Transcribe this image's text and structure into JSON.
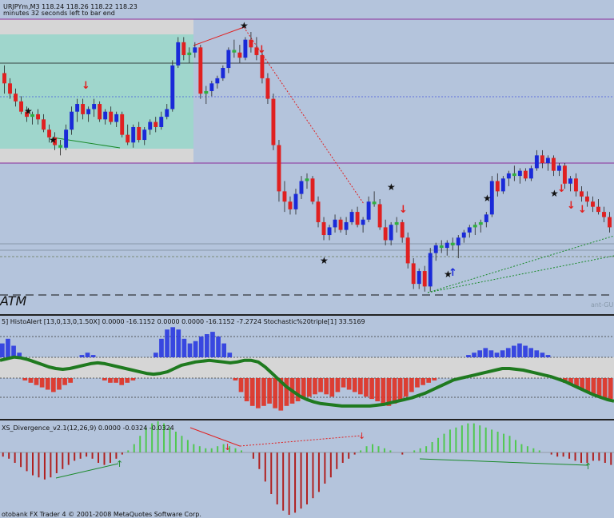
{
  "main": {
    "title_line": "URJPYm,M3  118.24 118.26 118.22 118.23",
    "timer_line": "minutes 32 seconds left to bar end",
    "atm_label": "ATM",
    "watermark": "ant-GU"
  },
  "panel1": {
    "title": "5] HistoAlert [13,0,13,0,1.50X] 0.0000 -16.1152 0.0000 0.0000 -16.1152 -7.2724  Stochastic%20triple[1] 33.5169"
  },
  "panel2": {
    "title": "XS_Divergence_v2.1(12,26,9) 0.0000 -0.0324 -0.0324"
  },
  "footer": {
    "text": "otobank FX Trader 4  © 2001-2008 MetaQuotes Software Corp."
  },
  "colors": {
    "background": "#b4c4dc",
    "bull": "#1a2ad8",
    "bear": "#e02020",
    "neutral": "#30b040",
    "zone": "#9fd6cc",
    "zone_gray": "#d6d6d6",
    "stoch": "#1f7a1f",
    "histo_up": "#2a3ae0",
    "histo_dn": "#e03020",
    "macd_up": "#50c850",
    "macd_dn": "#b02020",
    "purple": "#8a2b9a"
  },
  "chart_data": [
    {
      "type": "candlestick",
      "ylim": [
        0,
        100
      ],
      "candles": [
        {
          "o": 70,
          "h": 73,
          "l": 62,
          "c": 66
        },
        {
          "o": 66,
          "h": 68,
          "l": 60,
          "c": 62
        },
        {
          "o": 62,
          "h": 64,
          "l": 57,
          "c": 59
        },
        {
          "o": 59,
          "h": 61,
          "l": 54,
          "c": 55
        },
        {
          "o": 55,
          "h": 57,
          "l": 51,
          "c": 53
        },
        {
          "o": 53,
          "h": 55,
          "l": 50,
          "c": 54
        },
        {
          "o": 54,
          "h": 56,
          "l": 50,
          "c": 52
        },
        {
          "o": 52,
          "h": 54,
          "l": 47,
          "c": 48
        },
        {
          "o": 48,
          "h": 50,
          "l": 43,
          "c": 45
        },
        {
          "o": 45,
          "h": 47,
          "l": 40,
          "c": 42
        },
        {
          "o": 42,
          "h": 44,
          "l": 38,
          "c": 41
        },
        {
          "o": 41,
          "h": 50,
          "l": 40,
          "c": 48
        },
        {
          "o": 48,
          "h": 57,
          "l": 46,
          "c": 55
        },
        {
          "o": 55,
          "h": 60,
          "l": 51,
          "c": 58
        },
        {
          "o": 58,
          "h": 60,
          "l": 52,
          "c": 54
        },
        {
          "o": 54,
          "h": 57,
          "l": 51,
          "c": 56
        },
        {
          "o": 56,
          "h": 60,
          "l": 53,
          "c": 58
        },
        {
          "o": 58,
          "h": 59,
          "l": 51,
          "c": 52
        },
        {
          "o": 52,
          "h": 56,
          "l": 50,
          "c": 55
        },
        {
          "o": 55,
          "h": 57,
          "l": 50,
          "c": 51
        },
        {
          "o": 51,
          "h": 55,
          "l": 49,
          "c": 54
        },
        {
          "o": 54,
          "h": 55,
          "l": 45,
          "c": 46
        },
        {
          "o": 46,
          "h": 50,
          "l": 42,
          "c": 43
        },
        {
          "o": 43,
          "h": 50,
          "l": 41,
          "c": 49
        },
        {
          "o": 49,
          "h": 51,
          "l": 43,
          "c": 44
        },
        {
          "o": 44,
          "h": 49,
          "l": 42,
          "c": 48
        },
        {
          "o": 48,
          "h": 52,
          "l": 46,
          "c": 51
        },
        {
          "o": 51,
          "h": 53,
          "l": 47,
          "c": 49
        },
        {
          "o": 49,
          "h": 55,
          "l": 48,
          "c": 53
        },
        {
          "o": 53,
          "h": 58,
          "l": 52,
          "c": 56
        },
        {
          "o": 56,
          "h": 75,
          "l": 55,
          "c": 73
        },
        {
          "o": 73,
          "h": 84,
          "l": 72,
          "c": 82
        },
        {
          "o": 82,
          "h": 84,
          "l": 75,
          "c": 77
        },
        {
          "o": 77,
          "h": 80,
          "l": 74,
          "c": 78
        },
        {
          "o": 78,
          "h": 82,
          "l": 76,
          "c": 80
        },
        {
          "o": 80,
          "h": 81,
          "l": 60,
          "c": 62
        },
        {
          "o": 62,
          "h": 65,
          "l": 58,
          "c": 63
        },
        {
          "o": 63,
          "h": 67,
          "l": 61,
          "c": 66
        },
        {
          "o": 66,
          "h": 69,
          "l": 64,
          "c": 68
        },
        {
          "o": 68,
          "h": 73,
          "l": 67,
          "c": 72
        },
        {
          "o": 72,
          "h": 80,
          "l": 70,
          "c": 79
        },
        {
          "o": 79,
          "h": 83,
          "l": 76,
          "c": 78
        },
        {
          "o": 78,
          "h": 81,
          "l": 74,
          "c": 76
        },
        {
          "o": 76,
          "h": 84,
          "l": 75,
          "c": 83
        },
        {
          "o": 83,
          "h": 86,
          "l": 78,
          "c": 80
        },
        {
          "o": 80,
          "h": 84,
          "l": 75,
          "c": 77
        },
        {
          "o": 77,
          "h": 79,
          "l": 66,
          "c": 68
        },
        {
          "o": 68,
          "h": 70,
          "l": 58,
          "c": 60
        },
        {
          "o": 60,
          "h": 62,
          "l": 40,
          "c": 42
        },
        {
          "o": 42,
          "h": 44,
          "l": 20,
          "c": 24
        },
        {
          "o": 24,
          "h": 28,
          "l": 16,
          "c": 20
        },
        {
          "o": 20,
          "h": 22,
          "l": 15,
          "c": 17
        },
        {
          "o": 17,
          "h": 25,
          "l": 15,
          "c": 23
        },
        {
          "o": 23,
          "h": 30,
          "l": 21,
          "c": 28
        },
        {
          "o": 28,
          "h": 31,
          "l": 25,
          "c": 29
        },
        {
          "o": 29,
          "h": 30,
          "l": 19,
          "c": 20
        },
        {
          "o": 20,
          "h": 22,
          "l": 10,
          "c": 12
        },
        {
          "o": 12,
          "h": 14,
          "l": 5,
          "c": 7
        },
        {
          "o": 7,
          "h": 11,
          "l": 5,
          "c": 10
        },
        {
          "o": 10,
          "h": 15,
          "l": 8,
          "c": 13
        },
        {
          "o": 13,
          "h": 14,
          "l": 8,
          "c": 9
        },
        {
          "o": 9,
          "h": 14,
          "l": 7,
          "c": 12
        },
        {
          "o": 12,
          "h": 17,
          "l": 11,
          "c": 16
        },
        {
          "o": 16,
          "h": 18,
          "l": 10,
          "c": 11
        },
        {
          "o": 11,
          "h": 14,
          "l": 8,
          "c": 13
        },
        {
          "o": 13,
          "h": 22,
          "l": 12,
          "c": 20
        },
        {
          "o": 20,
          "h": 24,
          "l": 18,
          "c": 19
        },
        {
          "o": 19,
          "h": 21,
          "l": 9,
          "c": 10
        },
        {
          "o": 10,
          "h": 13,
          "l": 3,
          "c": 5
        },
        {
          "o": 5,
          "h": 12,
          "l": 3,
          "c": 11
        },
        {
          "o": 11,
          "h": 14,
          "l": 8,
          "c": 12
        },
        {
          "o": 12,
          "h": 13,
          "l": 4,
          "c": 6
        },
        {
          "o": 6,
          "h": 8,
          "l": -6,
          "c": -4
        },
        {
          "o": -4,
          "h": -2,
          "l": -14,
          "c": -12
        },
        {
          "o": -12,
          "h": -6,
          "l": -14,
          "c": -7
        },
        {
          "o": -7,
          "h": -5,
          "l": -15,
          "c": -13
        },
        {
          "o": -13,
          "h": 2,
          "l": -15,
          "c": 0
        },
        {
          "o": 0,
          "h": 4,
          "l": -3,
          "c": 3
        },
        {
          "o": 3,
          "h": 5,
          "l": 0,
          "c": 2
        },
        {
          "o": 2,
          "h": 5,
          "l": -1,
          "c": 4
        },
        {
          "o": 4,
          "h": 6,
          "l": 1,
          "c": 3
        },
        {
          "o": 3,
          "h": 7,
          "l": -2,
          "c": 6
        },
        {
          "o": 6,
          "h": 9,
          "l": 4,
          "c": 8
        },
        {
          "o": 8,
          "h": 11,
          "l": 6,
          "c": 10
        },
        {
          "o": 10,
          "h": 12,
          "l": 7,
          "c": 11
        },
        {
          "o": 11,
          "h": 13,
          "l": 8,
          "c": 12
        },
        {
          "o": 12,
          "h": 16,
          "l": 10,
          "c": 15
        },
        {
          "o": 15,
          "h": 30,
          "l": 14,
          "c": 28
        },
        {
          "o": 28,
          "h": 31,
          "l": 22,
          "c": 24
        },
        {
          "o": 24,
          "h": 30,
          "l": 23,
          "c": 29
        },
        {
          "o": 29,
          "h": 32,
          "l": 26,
          "c": 31
        },
        {
          "o": 31,
          "h": 34,
          "l": 28,
          "c": 30
        },
        {
          "o": 30,
          "h": 33,
          "l": 27,
          "c": 32
        },
        {
          "o": 32,
          "h": 33,
          "l": 28,
          "c": 29
        },
        {
          "o": 29,
          "h": 34,
          "l": 28,
          "c": 33
        },
        {
          "o": 33,
          "h": 40,
          "l": 32,
          "c": 38
        },
        {
          "o": 38,
          "h": 40,
          "l": 33,
          "c": 35
        },
        {
          "o": 35,
          "h": 38,
          "l": 32,
          "c": 37
        },
        {
          "o": 37,
          "h": 38,
          "l": 30,
          "c": 32
        },
        {
          "o": 32,
          "h": 35,
          "l": 30,
          "c": 34
        },
        {
          "o": 34,
          "h": 35,
          "l": 25,
          "c": 27
        },
        {
          "o": 27,
          "h": 30,
          "l": 24,
          "c": 29
        },
        {
          "o": 29,
          "h": 31,
          "l": 22,
          "c": 24
        },
        {
          "o": 24,
          "h": 26,
          "l": 20,
          "c": 22
        },
        {
          "o": 22,
          "h": 24,
          "l": 18,
          "c": 20
        },
        {
          "o": 20,
          "h": 22,
          "l": 16,
          "c": 18
        },
        {
          "o": 18,
          "h": 21,
          "l": 15,
          "c": 16
        },
        {
          "o": 16,
          "h": 18,
          "l": 12,
          "c": 14
        },
        {
          "o": 14,
          "h": 16,
          "l": 8,
          "c": 10
        }
      ]
    },
    {
      "type": "histogram",
      "name": "HistoAlert",
      "values": [
        6,
        8,
        5,
        2,
        -1,
        -2,
        -3,
        -4,
        -5,
        -6,
        -5,
        -3,
        -2,
        0,
        1,
        2,
        1,
        0,
        -1,
        -2,
        -2,
        -3,
        -2,
        -1,
        0,
        0,
        0,
        2,
        8,
        12,
        13,
        12,
        8,
        6,
        7,
        9,
        10,
        11,
        9,
        6,
        2,
        -1,
        -6,
        -10,
        -12,
        -13,
        -12,
        -11,
        -13,
        -14,
        -12,
        -11,
        -10,
        -9,
        -8,
        -7,
        -6,
        -7,
        -8,
        -6,
        -4,
        -5,
        -6,
        -7,
        -8,
        -9,
        -10,
        -11,
        -12,
        -11,
        -10,
        -8,
        -6,
        -4,
        -3,
        -2,
        -1,
        0,
        0,
        0,
        0,
        0,
        1,
        2,
        3,
        4,
        3,
        2,
        3,
        4,
        5,
        6,
        5,
        4,
        3,
        2,
        1,
        0,
        -1,
        -2,
        -3,
        -4,
        -5,
        -6,
        -7,
        -8,
        -9,
        -9
      ],
      "ylim": [
        -16,
        16
      ]
    },
    {
      "type": "line",
      "name": "Stochastic%20triple",
      "values": [
        60,
        62,
        64,
        63,
        61,
        58,
        55,
        52,
        50,
        49,
        50,
        52,
        54,
        56,
        57,
        56,
        54,
        52,
        50,
        48,
        46,
        44,
        43,
        44,
        46,
        50,
        54,
        56,
        58,
        59,
        60,
        59,
        58,
        57,
        58,
        60,
        60,
        58,
        52,
        44,
        36,
        28,
        22,
        16,
        12,
        9,
        7,
        6,
        5,
        4,
        4,
        4,
        4,
        4,
        5,
        6,
        8,
        10,
        12,
        14,
        17,
        20,
        24,
        28,
        32,
        36,
        38,
        40,
        42,
        44,
        46,
        48,
        50,
        50,
        49,
        48,
        46,
        44,
        42,
        40,
        37,
        34,
        30,
        26,
        22,
        18,
        15,
        12,
        10
      ],
      "ylim": [
        0,
        100
      ]
    },
    {
      "type": "bar",
      "name": "XS_Divergence_v2.1",
      "values": [
        -2,
        -3,
        -5,
        -7,
        -9,
        -11,
        -12,
        -13,
        -12,
        -10,
        -8,
        -6,
        -4,
        -3,
        -2,
        -3,
        -5,
        -6,
        -5,
        -3,
        -1,
        1,
        4,
        8,
        12,
        14,
        15,
        14,
        12,
        10,
        8,
        6,
        4,
        3,
        2,
        2,
        3,
        4,
        3,
        2,
        1,
        0,
        -3,
        -8,
        -14,
        -20,
        -25,
        -28,
        -30,
        -29,
        -27,
        -25,
        -22,
        -19,
        -15,
        -12,
        -8,
        -5,
        -3,
        -1,
        1,
        3,
        4,
        3,
        2,
        1,
        0,
        -1,
        0,
        1,
        2,
        3,
        5,
        7,
        9,
        11,
        12,
        13,
        14,
        14,
        13,
        12,
        11,
        10,
        9,
        8,
        6,
        4,
        3,
        2,
        1,
        0,
        -1,
        -2,
        -2,
        -3,
        -4,
        -5,
        -5,
        -4,
        -4,
        -5,
        -6
      ],
      "ylim": [
        -32,
        18
      ]
    }
  ]
}
